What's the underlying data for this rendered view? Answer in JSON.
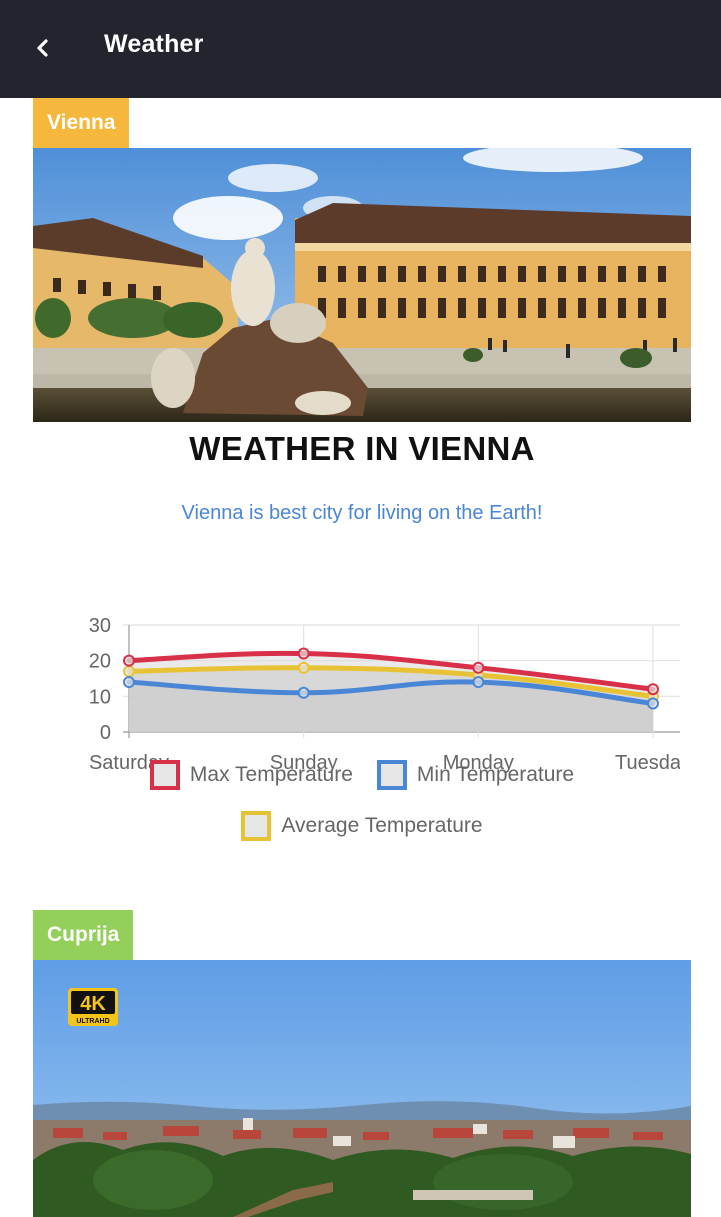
{
  "header": {
    "title": "Weather",
    "back_icon": "chevron-left-icon"
  },
  "colors": {
    "header_bg": "#23252e",
    "vienna_tag": "#f5b83c",
    "cuprija_tag": "#94cf5b",
    "subtitle": "#4a86d6",
    "max": "#d9304a",
    "min": "#4a86d6",
    "avg": "#e8c235"
  },
  "cards": [
    {
      "tag": "Vienna",
      "image": "Schönbrunn palace with fountain sculpture",
      "title": "WEATHER IN VIENNA",
      "subtitle": "Vienna is best city for living on the Earth!"
    },
    {
      "tag": "Cuprija",
      "image": "Town panorama with river and bridge",
      "badge_main": "4K",
      "badge_sub": "ULTRAHD"
    }
  ],
  "chart_data": {
    "type": "line",
    "categories": [
      "Saturday",
      "Sunday",
      "Monday",
      "Tuesday"
    ],
    "ylim": [
      0,
      30
    ],
    "yticks": [
      0,
      10,
      20,
      30
    ],
    "grid": true,
    "series": [
      {
        "name": "Max Temperature",
        "values": [
          20,
          22,
          18,
          12
        ],
        "color": "#d9304a"
      },
      {
        "name": "Min Temperature",
        "values": [
          14,
          11,
          14,
          8
        ],
        "color": "#4a86d6"
      },
      {
        "name": "Average Temperature",
        "values": [
          17,
          18,
          16,
          10
        ],
        "color": "#e8c235"
      }
    ]
  }
}
